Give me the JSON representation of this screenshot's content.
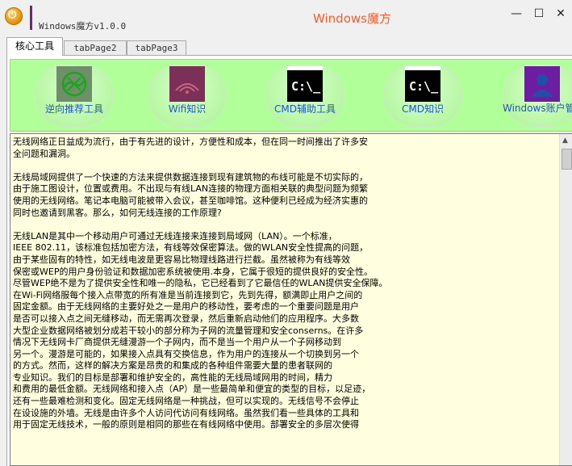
{
  "window": {
    "app_title": "Windows魔方v1.0.0",
    "brand_title": "Windows魔方",
    "app_icon_glyph": "⏻",
    "controls": {
      "minimize": "—",
      "maximize": "☐",
      "close": "✕"
    }
  },
  "tabs": [
    {
      "label": "核心工具",
      "active": true
    },
    {
      "label": "tabPage2",
      "active": false
    },
    {
      "label": "tabPage3",
      "active": false
    }
  ],
  "tools": [
    {
      "label": "逆向推荐工具",
      "icon": "reverse-tool-icon",
      "color": "#6f8f6a"
    },
    {
      "label": "Wifi知识",
      "icon": "wifi-icon",
      "color": "#7c2f57"
    },
    {
      "label": "CMD辅助工具",
      "icon": "cmd-icon",
      "tile_text": "C:\\_",
      "color": "#000000"
    },
    {
      "label": "CMD知识",
      "icon": "cmd-icon",
      "tile_text": "C:\\_",
      "color": "#000000"
    },
    {
      "label": "Windows账户管理",
      "icon": "user-account-icon",
      "color": "#6d1ea0"
    }
  ],
  "content": {
    "text": "无线网络正日益成为流行，由于有先进的设计，方便性和成本，但在同一时间推出了许多安\n全问题和漏洞。\n\n无线局域网提供了一个快速的方法来提供数据连接到现有建筑物的布线可能是不切实际的，\n由于施工图设计，位置或费用。不出现与有线LAN连接的物理方面相关联的典型问题为频繁\n使用的无线网络。笔记本电脑可能被带入会议，甚至咖啡馆。这种便利已经成为经济实惠的\n同时也邀请到黑客。那么，如何无线连接的工作原理?\n\n无线LAN是其中一个移动用户可通过无线连接来连接到局域网（LAN）。一个标准，\nIEEE 802.11，该标准包括加密方法，有线等效保密算法。做的WLAN安全性提高的问题，\n由于某些固有的特性，如无线电波是更容易比物理线路进行拦截。虽然被称为有线等效\n保密或WEP的用户身份验证和数据加密系统被使用.本身，它属于很短的提供良好的安全性。\n尽管WEP绝不是为了提供安全性和唯一的隐私，它已经看到了它最信任的WLAN提供安全保障。\n在Wi-Fi网络服每个接入点带宽的所有准是当前连接到它，先到先得，额满即止用户之间的\n固定金额。由于无线网络的主要好处之一是用户的移动性，要考虑的一个重要问题是用户\n是否可以接入点之间无缝移动，而无需再次登录，然后重新启动他们的应用程序。大多数\n大型企业数据网络被划分成若干较小的部分称为子网的流量管理和安全conserns。在许多\n情况下无线网卡厂商提供无缝漫游一个子网内，而不是当一个用户从一个子网移动到\n另一个。漫游是可能的，如果接入点具有交换信息，作为用户的连接从一个切换到另一个\n的方式。然而，这样的解决方案是昂贵的和集成的各种组件需要大量的患者联网的\n专业知识。我们的目标是部署和维护安全的，高性能的无线局域网用的时间，精力\n和费用的最低金额。无线网络和接入点（AP）是一些最简单和便宜的类型的目标，以足迹，\n还有一些最难检测和变化。固定无线网络是一种挑战，但可以实现的。无线信号不会停止\n在设设施的外墙。无线是由许多个人访问代访问有线网络。虽然我们看一些具体的工具和\n用于固定无线技术，一般的原则是相同的那些在有线网络中使用。部署安全的多层次使得"
  }
}
